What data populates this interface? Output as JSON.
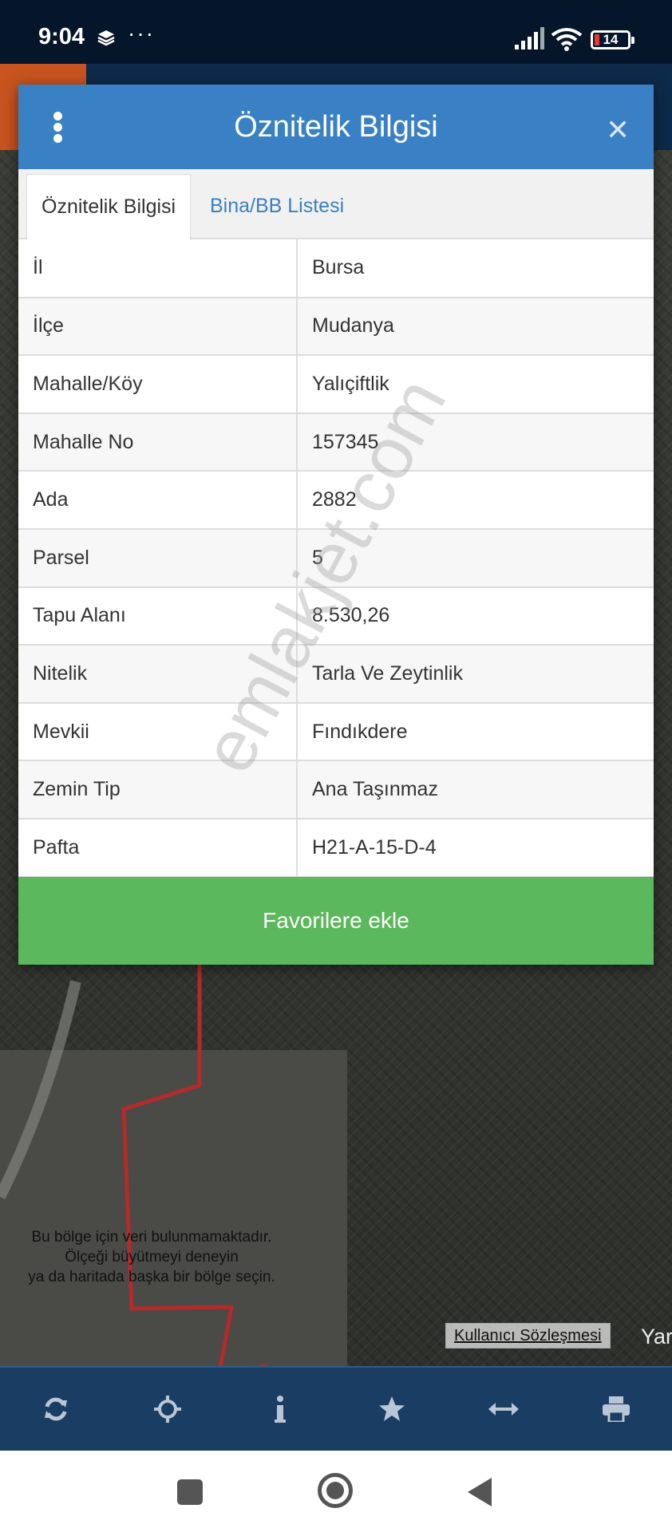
{
  "status_bar": {
    "time": "9:04",
    "dots": "···",
    "battery": "14"
  },
  "map": {
    "no_data_lines": [
      "Bu bölge için veri bulunmamaktadır.",
      "Ölçeği büyütmeyi deneyin",
      "ya da haritada başka bir bölge seçin."
    ],
    "user_agreement": "Kullanıcı Sözleşmesi",
    "partial_text": "Yar"
  },
  "modal": {
    "title": "Öznitelik Bilgisi",
    "tabs": [
      {
        "label": "Öznitelik Bilgisi",
        "active": true
      },
      {
        "label": "Bina/BB Listesi",
        "active": false
      }
    ],
    "rows": [
      {
        "key": "İl",
        "value": "Bursa"
      },
      {
        "key": "İlçe",
        "value": "Mudanya"
      },
      {
        "key": "Mahalle/Köy",
        "value": "Yalıçiftlik"
      },
      {
        "key": "Mahalle No",
        "value": "157345"
      },
      {
        "key": "Ada",
        "value": "2882"
      },
      {
        "key": "Parsel",
        "value": "5"
      },
      {
        "key": "Tapu Alanı",
        "value": "8.530,26"
      },
      {
        "key": "Nitelik",
        "value": "Tarla Ve Zeytinlik"
      },
      {
        "key": "Mevkii",
        "value": "Fındıkdere"
      },
      {
        "key": "Zemin Tip",
        "value": "Ana Taşınmaz"
      },
      {
        "key": "Pafta",
        "value": "H21-A-15-D-4"
      }
    ],
    "favorite_button": "Favorilere ekle"
  },
  "watermark": "emlakjet.com",
  "colors": {
    "header": "#3a80c4",
    "favorite": "#5cb85c",
    "toolbar": "#1a3d63",
    "status": "#06162a"
  },
  "toolbar_icons": [
    "refresh-icon",
    "locate-icon",
    "info-icon",
    "star-icon",
    "measure-icon",
    "print-icon"
  ]
}
